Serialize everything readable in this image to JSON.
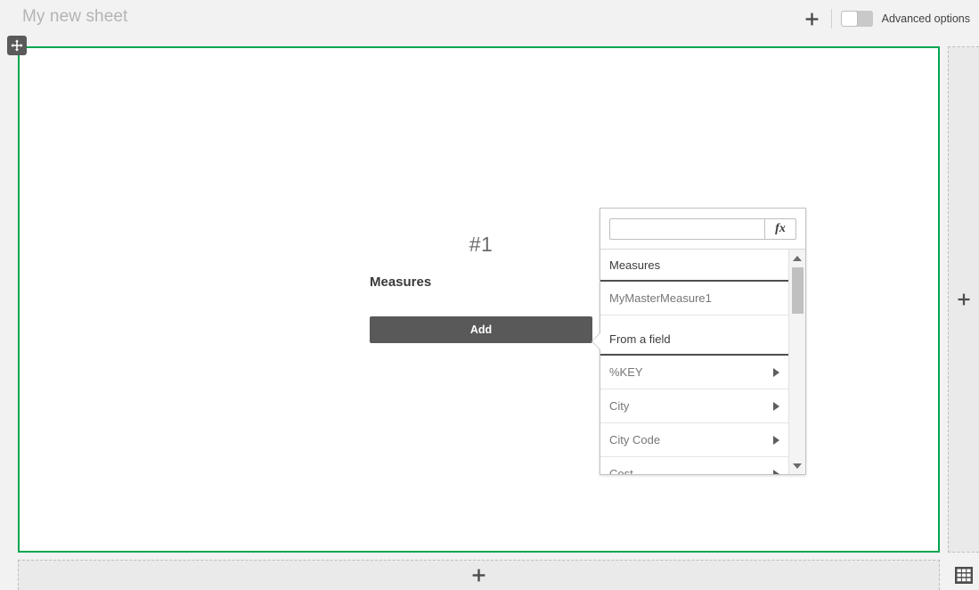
{
  "topbar": {
    "sheet_title": "My new sheet",
    "add_icon": "plus-icon",
    "advanced_options_label": "Advanced options",
    "advanced_options_state": "off"
  },
  "sheet": {
    "move_handle_icon": "move-arrows-icon",
    "border_color": "#00a64f",
    "background": "#ffffff"
  },
  "measure_block": {
    "index_label": "#1",
    "section_label": "Measures",
    "add_button_label": "Add"
  },
  "popover": {
    "search_value": "",
    "search_placeholder": "",
    "fx_button_label": "fx",
    "groups": [
      {
        "header": "Measures",
        "items": [
          {
            "label": "MyMasterMeasure1",
            "has_arrow": false
          }
        ]
      },
      {
        "header": "From a field",
        "items": [
          {
            "label": "%KEY",
            "has_arrow": true
          },
          {
            "label": "City",
            "has_arrow": true
          },
          {
            "label": "City Code",
            "has_arrow": true
          },
          {
            "label": "Cost",
            "has_arrow": true
          }
        ]
      }
    ],
    "scrollbar": {
      "up_icon": "triangle-up-icon",
      "down_icon": "triangle-down-icon"
    }
  },
  "dropzones": {
    "right_icon": "plus-icon",
    "bottom_icon": "plus-icon",
    "grid_toggle_icon": "grid-icon"
  }
}
